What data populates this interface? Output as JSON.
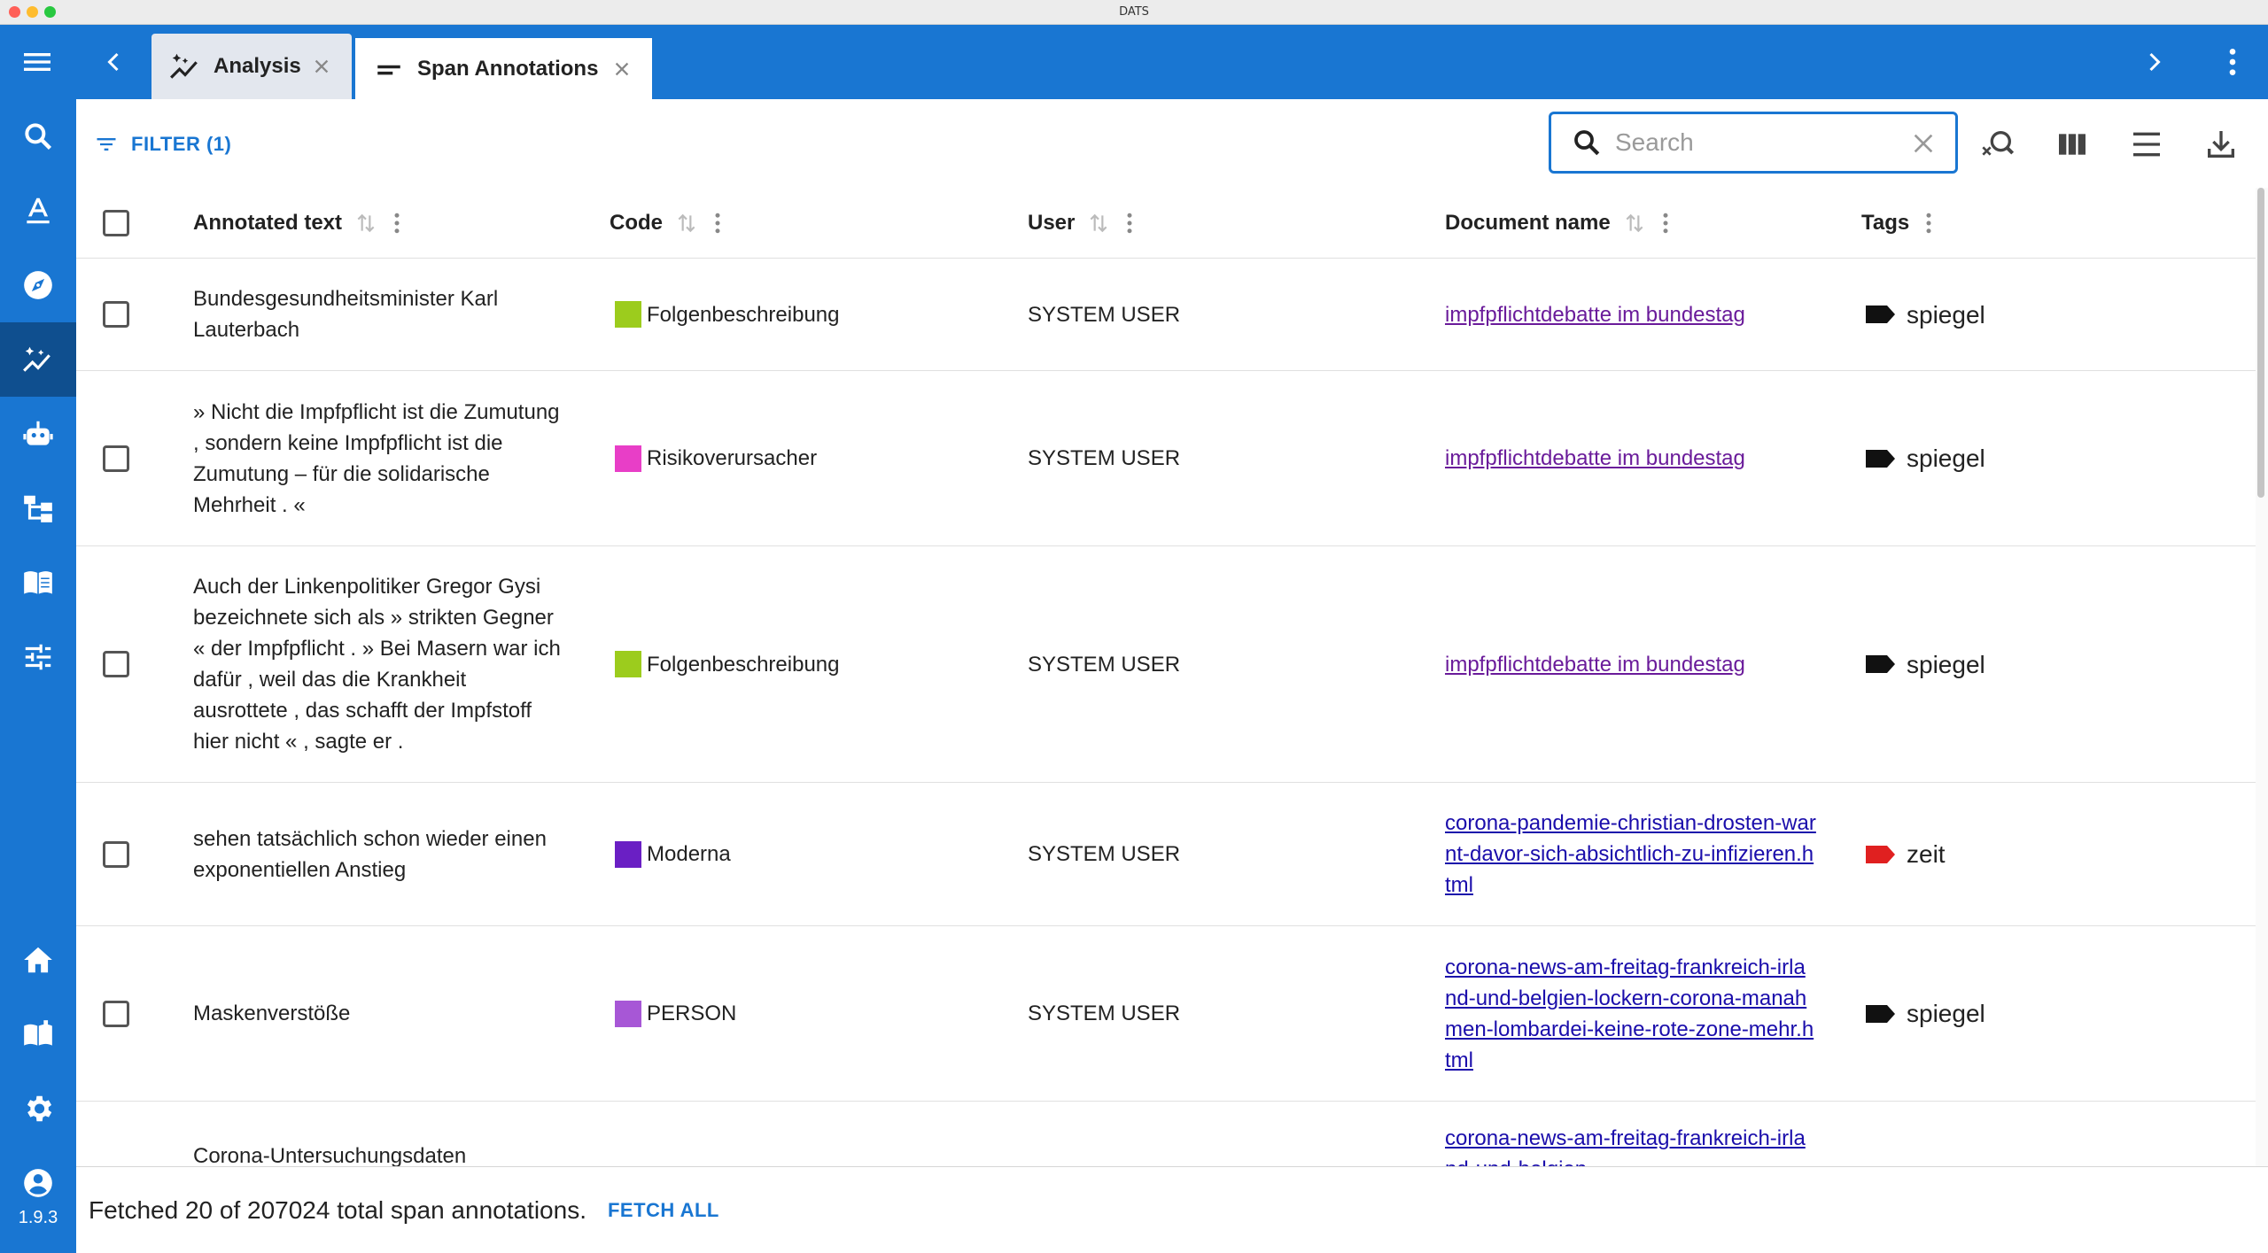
{
  "window": {
    "title": "DATS"
  },
  "colors": {
    "primary": "#1976d2",
    "sidebar_active": "#0f4f8f",
    "link": "#1a0dab",
    "link_visited": "#6a1b9a"
  },
  "appbar": {
    "menu_icon": "hamburger-icon",
    "back_icon": "chevron-left-icon",
    "forward_icon": "chevron-right-icon",
    "more_icon": "more-vertical-icon",
    "tabs": [
      {
        "label": "Analysis",
        "icon": "analysis-icon",
        "active": false
      },
      {
        "label": "Span Annotations",
        "icon": "short-text-icon",
        "active": true
      }
    ]
  },
  "sidebar": {
    "items": [
      {
        "name": "search",
        "icon": "search-icon"
      },
      {
        "name": "annotation",
        "icon": "text-format-icon"
      },
      {
        "name": "explore",
        "icon": "compass-icon"
      },
      {
        "name": "analysis",
        "icon": "analysis-icon",
        "active": true
      },
      {
        "name": "assistant",
        "icon": "robot-icon"
      },
      {
        "name": "hierarchy",
        "icon": "hierarchy-icon"
      },
      {
        "name": "logbook",
        "icon": "book-icon"
      },
      {
        "name": "settings-tune",
        "icon": "tune-icon"
      },
      {
        "name": "home",
        "icon": "home-icon"
      },
      {
        "name": "docs",
        "icon": "manual-icon"
      },
      {
        "name": "settings",
        "icon": "gear-icon"
      },
      {
        "name": "account",
        "icon": "account-icon"
      }
    ],
    "version": "1.9.3"
  },
  "toolbar": {
    "filter_label": "FILTER (1)",
    "search_placeholder": "Search"
  },
  "table": {
    "columns": {
      "annotated_text": "Annotated text",
      "code": "Code",
      "user": "User",
      "document_name": "Document name",
      "tags": "Tags"
    },
    "rows": [
      {
        "text": "Bundesgesundheitsminister Karl Lauterbach",
        "code": "Folgenbeschreibung",
        "code_color": "#9ccc1d",
        "user": "SYSTEM USER",
        "document": "impfpflichtdebatte im bundestag",
        "visited": true,
        "tag": "spiegel",
        "tag_color": "#111111"
      },
      {
        "text": "» Nicht die Impfpflicht ist die Zumutung , sondern keine Impfpflicht ist die Zumutung – für die solidarische Mehrheit . «",
        "code": "Risikoverursacher",
        "code_color": "#e83ec7",
        "user": "SYSTEM USER",
        "document": "impfpflichtdebatte im bundestag",
        "visited": true,
        "tag": "spiegel",
        "tag_color": "#111111"
      },
      {
        "text": "Auch der Linkenpolitiker Gregor Gysi bezeichnete sich als » strikten Gegner « der Impfpflicht . » Bei Masern war ich dafür , weil das die Krankheit ausrottete , das schafft der Impfstoff hier nicht « , sagte er .",
        "code": "Folgenbeschreibung",
        "code_color": "#9ccc1d",
        "user": "SYSTEM USER",
        "document": "impfpflichtdebatte im bundestag",
        "visited": true,
        "tag": "spiegel",
        "tag_color": "#111111"
      },
      {
        "text": "sehen tatsächlich schon wieder einen exponentiellen Anstieg",
        "code": "Moderna",
        "code_color": "#6a1fc4",
        "user": "SYSTEM USER",
        "document": "corona-pandemie-christian-drosten-warnt-davor-sich-absichtlich-zu-infizieren.html",
        "visited": false,
        "tag": "zeit",
        "tag_color": "#e02020"
      },
      {
        "text": "Maskenverstöße",
        "code": "PERSON",
        "code_color": "#a757d6",
        "user": "SYSTEM USER",
        "document": "corona-news-am-freitag-frankreich-irland-und-belgien-lockern-corona-manahmen-lombardei-keine-rote-zone-mehr.html",
        "visited": false,
        "tag": "spiegel",
        "tag_color": "#111111"
      },
      {
        "text": "Corona-Untersuchungsdaten",
        "code": "",
        "code_color": "",
        "user": "",
        "document": "corona-news-am-freitag-frankreich-irland-und-belgien",
        "visited": false,
        "tag": "",
        "tag_color": ""
      }
    ]
  },
  "footer": {
    "status": "Fetched 20 of 207024 total span annotations.",
    "fetch_all_label": "FETCH ALL"
  }
}
